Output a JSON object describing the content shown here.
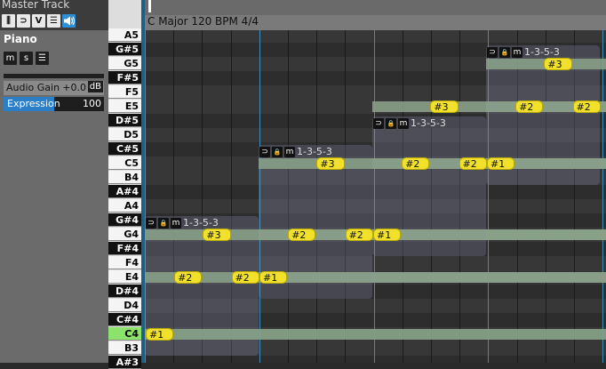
{
  "master": {
    "title": "Master Track",
    "buttons": [
      {
        "icon": "piano-icon",
        "glyph": "⫼",
        "active": false
      },
      {
        "icon": "loop-icon",
        "glyph": "⊃",
        "active": false
      },
      {
        "icon": "chevron-v-icon",
        "glyph": "V",
        "active": false
      },
      {
        "icon": "menu-icon",
        "glyph": "☰",
        "active": false
      },
      {
        "icon": "speaker-icon",
        "glyph": "🔊",
        "active": true
      }
    ]
  },
  "track": {
    "name": "Piano",
    "buttons": [
      "m",
      "s",
      "☰"
    ],
    "gain": {
      "label": "Audio Gain",
      "value": "+0.0",
      "unit": "dB"
    },
    "expression": {
      "label": "Expression",
      "value": "100",
      "fill": 0.5
    }
  },
  "keys": [
    "A5",
    "G#5",
    "G5",
    "F#5",
    "F5",
    "E5",
    "D#5",
    "D5",
    "C#5",
    "C5",
    "B4",
    "A#4",
    "A4",
    "G#4",
    "G4",
    "F#4",
    "F4",
    "E4",
    "D#4",
    "D4",
    "C#4",
    "C4",
    "B3",
    "A#3"
  ],
  "header": {
    "info": "C Major  120 BPM  4/4"
  },
  "chords": [
    {
      "label": "1-3-5-3",
      "notes": [
        {
          "t": "#1"
        },
        {
          "t": "#2"
        },
        {
          "t": "#3"
        },
        {
          "t": "#2"
        }
      ]
    },
    {
      "label": "1-3-5-3",
      "notes": [
        {
          "t": "#1"
        },
        {
          "t": "#2"
        },
        {
          "t": "#3"
        },
        {
          "t": "#2"
        }
      ]
    },
    {
      "label": "1-3-5-3",
      "notes": [
        {
          "t": "#1"
        },
        {
          "t": "#2"
        },
        {
          "t": "#3"
        },
        {
          "t": "#2"
        }
      ]
    },
    {
      "label": "1-3-5-3",
      "notes": [
        {
          "t": "#1"
        },
        {
          "t": "#2"
        },
        {
          "t": "#3"
        },
        {
          "t": "#2"
        }
      ]
    }
  ],
  "colors": {
    "accent": "#2f8fd6",
    "note": "#f1e12a",
    "highlight_key": "#8be36c"
  }
}
